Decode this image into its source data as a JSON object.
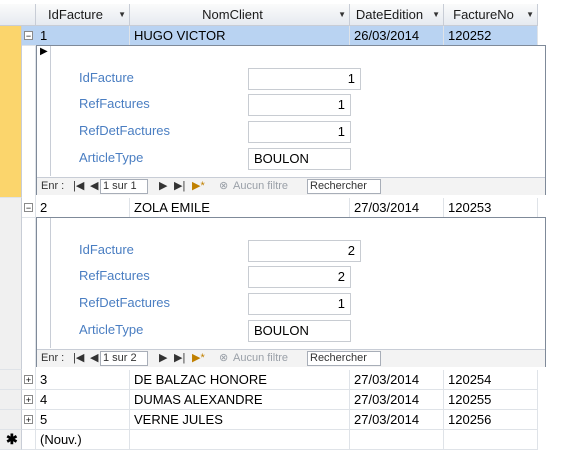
{
  "columns": [
    {
      "label": "IdFacture"
    },
    {
      "label": "NomClient"
    },
    {
      "label": "DateEdition"
    },
    {
      "label": "FactureNo"
    }
  ],
  "rows": [
    {
      "id": "1",
      "client": "HUGO VICTOR",
      "date": "26/03/2014",
      "no": "120252"
    },
    {
      "id": "2",
      "client": "ZOLA EMILE",
      "date": "27/03/2014",
      "no": "120253"
    },
    {
      "id": "3",
      "client": "DE BALZAC HONORE",
      "date": "27/03/2014",
      "no": "120254"
    },
    {
      "id": "4",
      "client": "DUMAS ALEXANDRE",
      "date": "27/03/2014",
      "no": "120255"
    },
    {
      "id": "5",
      "client": "VERNE JULES",
      "date": "27/03/2014",
      "no": "120256"
    }
  ],
  "new_row_label": "(Nouv.)",
  "subform_labels": {
    "idfacture": "IdFacture",
    "reffactures": "RefFactures",
    "refdet": "RefDetFactures",
    "articletype": "ArticleType"
  },
  "subforms": [
    {
      "idfacture": "1",
      "reffactures": "1",
      "refdet": "1",
      "articletype": "BOULON",
      "record": "1 sur 1"
    },
    {
      "idfacture": "2",
      "reffactures": "2",
      "refdet": "1",
      "articletype": "BOULON",
      "record": "1 sur 2"
    }
  ],
  "nav": {
    "label": "Enr :",
    "nofilter": "Aucun filtre",
    "search": "Rechercher"
  },
  "icons": {
    "expand": "plus-icon",
    "collapse": "minus-icon",
    "current": "triangle-right-icon",
    "new": "asterisk-icon",
    "filter": "funnel-icon"
  }
}
